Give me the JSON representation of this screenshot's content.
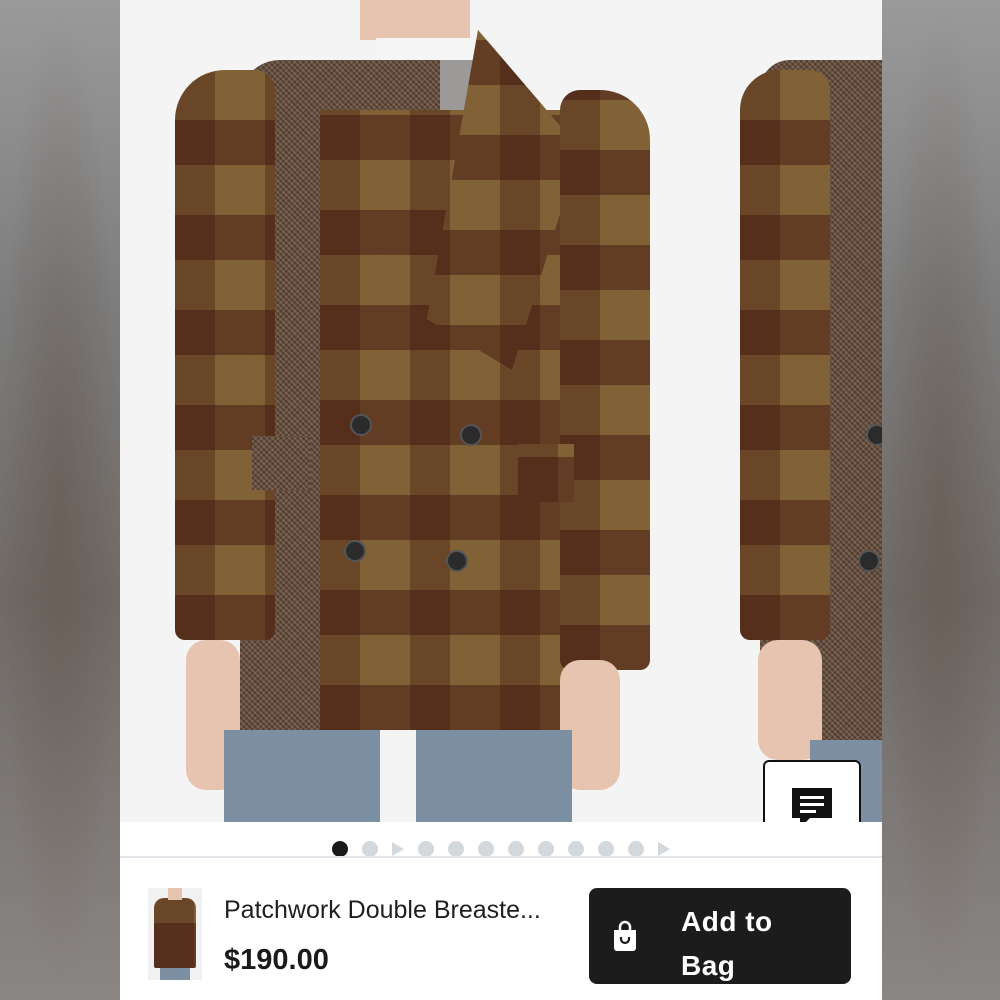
{
  "product": {
    "name": "Patchwork Double Breaste...",
    "price": "$190.00"
  },
  "actions": {
    "add_to_bag_label": "Add to Bag"
  },
  "gallery": {
    "image_count": 12,
    "current_index": 1,
    "video_slide_positions": [
      3,
      12
    ]
  },
  "icons": {
    "chat": "chat-bubble-icon",
    "bag": "shopping-bag-icon"
  },
  "colors": {
    "button_bg": "#1c1c1c",
    "dot_active": "#1a1a1a",
    "dot_inactive": "#d3d8dd"
  }
}
